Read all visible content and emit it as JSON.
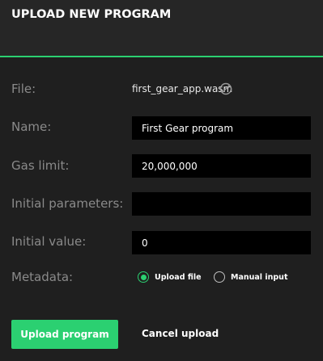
{
  "header": {
    "title": "UPLOAD NEW PROGRAM"
  },
  "labels": {
    "file": "File:",
    "name": "Name:",
    "gas_limit": "Gas limit:",
    "initial_parameters": "Initial parameters:",
    "initial_value": "Initial value:",
    "metadata": "Metadata:"
  },
  "fields": {
    "file_name": "first_gear_app.wasm",
    "file_remove_icon": "circle-slash-icon",
    "name_value": "First Gear program",
    "gas_limit_value": "20,000,000",
    "initial_parameters_value": "",
    "initial_value_value": "0"
  },
  "metadata_options": [
    {
      "label": "Upload file",
      "selected": true
    },
    {
      "label": "Manual input",
      "selected": false
    }
  ],
  "actions": {
    "upload_label": "Upload program",
    "cancel_label": "Cancel upload"
  },
  "colors": {
    "accent": "#2bd071",
    "background": "#1f1f1f",
    "input_background": "#000000",
    "label": "#8a8a8a"
  }
}
